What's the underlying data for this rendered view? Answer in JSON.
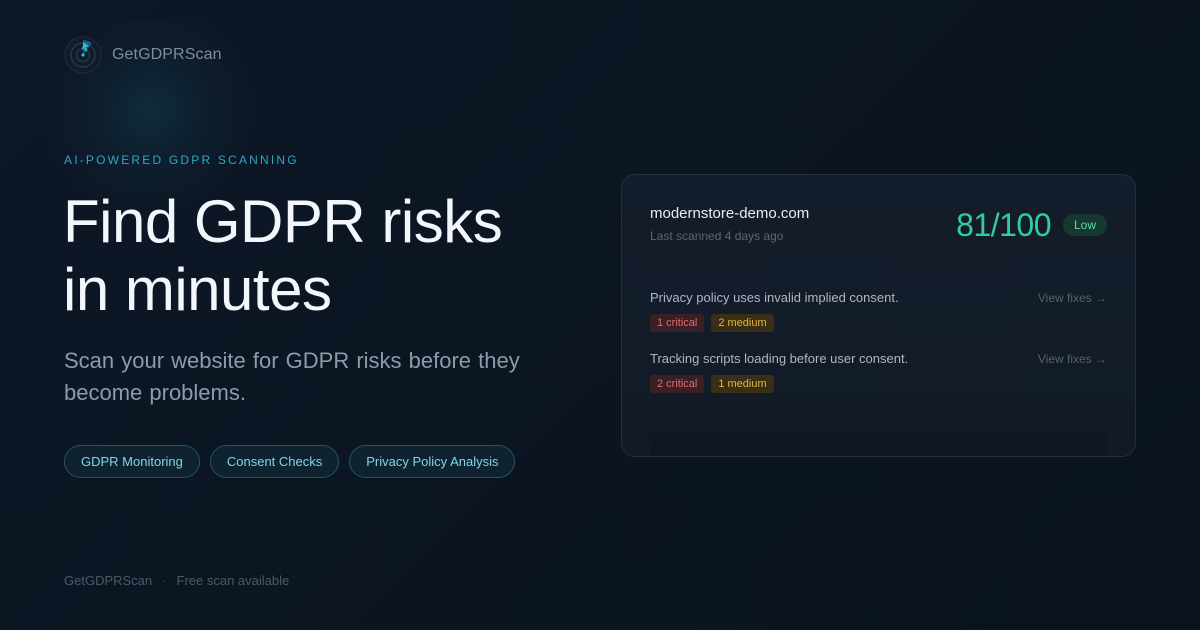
{
  "brand": {
    "name": "GetGDPRScan",
    "logo_icon": "radar-icon"
  },
  "hero": {
    "eyebrow": "AI-POWERED GDPR SCANNING",
    "headline_line1": "Find GDPR risks",
    "headline_line2": "in minutes",
    "subhead": "Scan your website for GDPR risks before they become problems."
  },
  "chips": [
    {
      "label": "GDPR Monitoring"
    },
    {
      "label": "Consent Checks"
    },
    {
      "label": "Privacy Policy Analysis"
    }
  ],
  "footer": {
    "brand": "GetGDPRScan",
    "separator": "·",
    "note": "Free scan available"
  },
  "scan_card": {
    "domain": "modernstore-demo.com",
    "last_scanned": "Last scanned 4 days ago",
    "score": "81/100",
    "risk_level": "Low",
    "issues": [
      {
        "text": "Privacy policy uses invalid implied consent.",
        "link": "View fixes →",
        "critical": "1 critical",
        "medium": "2 medium"
      },
      {
        "text": "Tracking scripts loading before user consent.",
        "link": "View fixes →",
        "critical": "2 critical",
        "medium": "1 medium"
      }
    ]
  },
  "colors": {
    "accent": "#2fa6c4",
    "score_green": "#2ecf9a",
    "critical_red": "#e36b72",
    "medium_yellow": "#e2b53c",
    "background": "#0c1522"
  }
}
